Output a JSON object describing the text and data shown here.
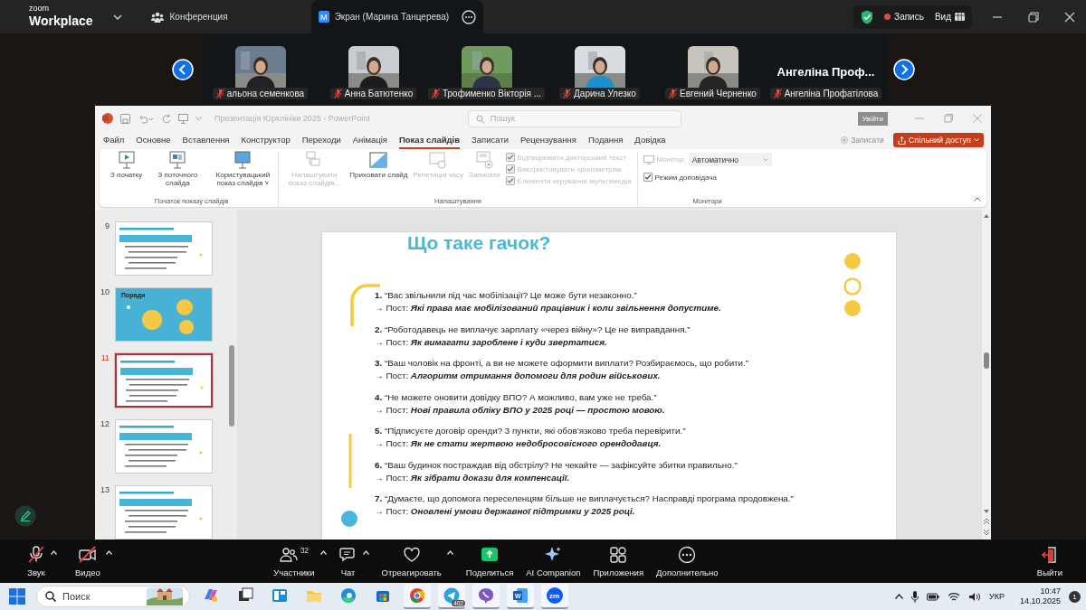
{
  "topbar": {
    "logo_small": "zoom",
    "logo": "Workplace",
    "tabs": [
      {
        "label": "Конференция",
        "selected": false
      },
      {
        "label": "Экран (Марина Танцерева)",
        "badge": "M",
        "selected": true
      }
    ],
    "record": "Запись",
    "view": "Вид"
  },
  "gallery": [
    {
      "kind": "picture",
      "name": "альона семенкова",
      "muted": true
    },
    {
      "kind": "picture",
      "name": "Анна Батютенко",
      "muted": true
    },
    {
      "kind": "picture",
      "name": "Трофименко Вікторія ...",
      "muted": true
    },
    {
      "kind": "picture",
      "name": "Дарина Улезко",
      "muted": true
    },
    {
      "kind": "picture",
      "name": "Евгений Черненко",
      "muted": true
    },
    {
      "kind": "name",
      "display": "Ангеліна Проф...",
      "name": "Ангеліна Профатілова",
      "muted": true
    }
  ],
  "powerpoint": {
    "title": "Презентація Юрклініки 2025 - PowerPoint",
    "search": {
      "placeholder": "Пошук"
    },
    "sign_in": "Увійти",
    "menu": [
      {
        "label": "Файл",
        "selected": false
      },
      {
        "label": "Основне",
        "selected": false
      },
      {
        "label": "Вставлення",
        "selected": false
      },
      {
        "label": "Конструктор",
        "selected": false
      },
      {
        "label": "Переходи",
        "selected": false
      },
      {
        "label": "Анімація",
        "selected": false
      },
      {
        "label": "Показ слайдів",
        "selected": true
      },
      {
        "label": "Записати",
        "selected": false
      },
      {
        "label": "Рецензування",
        "selected": false
      },
      {
        "label": "Подання",
        "selected": false
      },
      {
        "label": "Довідка",
        "selected": false
      }
    ],
    "record": {
      "label": "Записати",
      "disabled": true
    },
    "share": "Спільний доступ",
    "ribbon": [
      {
        "label": "Початок показу слайдів",
        "buttons": [
          {
            "label": "З початку",
            "disabled": false
          },
          {
            "label": "З поточного слайда",
            "disabled": false
          },
          {
            "label": "Користувацький показ слайдів ˅",
            "disabled": false
          }
        ]
      },
      {
        "label": "Налаштування",
        "buttons": [
          {
            "label": "Налаштувати показ слайдів...",
            "disabled": true
          },
          {
            "label": "Приховати слайд",
            "disabled": false
          },
          {
            "label": "Репетиція часу",
            "disabled": true
          },
          {
            "label": "Записати",
            "disabled": true
          }
        ],
        "checks": [
          {
            "label": "Відтворювати дикторський текст",
            "checked": true,
            "disabled": true
          },
          {
            "label": "Використовувати хронометраж",
            "checked": true,
            "disabled": true
          },
          {
            "label": "Елементи керування мультимедіа",
            "checked": true,
            "disabled": true
          }
        ]
      },
      {
        "label": "Монітори",
        "monitor_label": "Монітор:",
        "monitor_value": "Автоматично",
        "checks": [
          {
            "label": "Режим доповідача",
            "checked": true,
            "disabled": false
          }
        ]
      }
    ],
    "thumbnails": [
      {
        "number": "9",
        "kind": "text",
        "selected": false
      },
      {
        "number": "10",
        "kind": "tips",
        "title": "Поради",
        "selected": false
      },
      {
        "number": "11",
        "kind": "text",
        "selected": true
      },
      {
        "number": "12",
        "kind": "text",
        "selected": false
      },
      {
        "number": "13",
        "kind": "text",
        "selected": false
      }
    ],
    "slide": {
      "title": "Що таке гачок?",
      "items": [
        {
          "number": "1.",
          "quote": "“Вас звільнили під час мобілізації? Це може бути незаконно.”",
          "post_label": "→ Пост:",
          "post": "Які права має мобілізований працівник і коли звільнення допустиме."
        },
        {
          "number": "2.",
          "quote": "“Роботодавець не виплачує зарплату «через війну»? Це не виправдання.”",
          "post_label": "→ Пост:",
          "post": "Як вимагати зароблене і куди звертатися."
        },
        {
          "number": "3.",
          "quote": "“Ваш чоловік на фронті, а ви не можете оформити виплати? Розбираємось, що робити.”",
          "post_label": "→ Пост:",
          "post": "Алгоритм отримання допомоги для родин військових."
        },
        {
          "number": "4.",
          "quote": "“Не можете оновити довідку ВПО? А можливо, вам уже не треба.”",
          "post_label": "→ Пост:",
          "post": "Нові правила обліку ВПО у 2025 році — простою мовою."
        },
        {
          "number": "5.",
          "quote": "“Підписуєте договір оренди? 3 пункти, які обов’язково треба перевірити.”",
          "post_label": "→ Пост:",
          "post": "Як не стати жертвою недобросовісного орендодавця."
        },
        {
          "number": "6.",
          "quote": "“Ваш будинок постраждав від обстрілу? Не чекайте — зафіксуйте збитки правильно.”",
          "post_label": "→ Пост:",
          "post": "Як зібрати докази для компенсації."
        },
        {
          "number": "7.",
          "quote": "“Думаєте, що допомога переселенцям більше не виплачується? Насправді програма продовжена.”",
          "post_label": "→ Пост:",
          "post": "Оновлені умови державної підтримки у 2025 році."
        }
      ]
    }
  },
  "toolbar": {
    "left": [
      {
        "label": "Звук",
        "off": true,
        "menu": true
      },
      {
        "label": "Видео",
        "off": true,
        "menu": true
      }
    ],
    "center": [
      {
        "label": "Участники",
        "count": "32",
        "menu": true
      },
      {
        "label": "Чат",
        "menu": true
      },
      {
        "label": "Отреагировать",
        "menu": true
      },
      {
        "label": "Поделиться",
        "menu": false
      },
      {
        "label": "AI Companion",
        "menu": false
      },
      {
        "label": "Приложения",
        "menu": false
      },
      {
        "label": "Дополнительно",
        "menu": false
      }
    ],
    "right": [
      {
        "label": "Выйти",
        "menu": false
      }
    ]
  },
  "taskbar": {
    "search": {
      "placeholder": "Поиск"
    },
    "apps": [
      {
        "running": false
      },
      {
        "running": false
      },
      {
        "running": false
      },
      {
        "running": false
      },
      {
        "running": false
      },
      {
        "running": false
      },
      {
        "running": true
      },
      {
        "running": true,
        "badge": "402"
      },
      {
        "running": true
      },
      {
        "running": true,
        "label": "W"
      },
      {
        "running": true,
        "label": "zm"
      }
    ],
    "language": "УКР",
    "time": "10:47",
    "date": "14.10.2025",
    "notifications": "1"
  }
}
